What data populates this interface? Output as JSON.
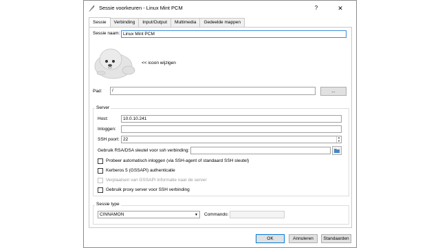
{
  "window": {
    "title": "Sessie voorkeuren - Linux Mint PCM",
    "help_label": "?",
    "close_label": "✕"
  },
  "tabs": [
    {
      "label": "Sessie",
      "active": true
    },
    {
      "label": "Verbinding",
      "active": false
    },
    {
      "label": "Input/Output",
      "active": false
    },
    {
      "label": "Multimedia",
      "active": false
    },
    {
      "label": "Gedeelde mappen",
      "active": false
    }
  ],
  "session": {
    "name_label": "Sessie naam:",
    "name_value": "Linux Mint PCM",
    "change_icon_label": "<< icoon wijzigen",
    "path_label": "Pad:",
    "path_value": "/",
    "browse_label": "..."
  },
  "server": {
    "group_title": "Server",
    "host_label": "Host:",
    "host_value": "10.0.10.241",
    "login_label": "Inloggen:",
    "login_value": "",
    "port_label": "SSH poort:",
    "port_value": "22",
    "key_label": "Gebruik RSA/DSA sleutel voor ssh verbinding:",
    "key_value": "",
    "options": [
      {
        "label": "Probeer automatisch inloggen (via SSH-agent of standaard SSH sleutel)",
        "checked": false,
        "disabled": false
      },
      {
        "label": "Kerberos 5 (GSSAPI) authenticatie",
        "checked": false,
        "disabled": false
      },
      {
        "label": "Verplaatsen van GSSAPI informatie naar de server",
        "checked": false,
        "disabled": true
      },
      {
        "label": "Gebruik proxy server voor SSH verbinding",
        "checked": false,
        "disabled": false
      }
    ]
  },
  "session_type": {
    "group_title": "Sessie type",
    "selected": "CINNAMON",
    "command_label": "Commando:",
    "command_value": ""
  },
  "buttons": {
    "ok": "OK",
    "cancel": "Annuleren",
    "defaults": "Standaarden"
  },
  "colors": {
    "focus_border": "#3c8ad8",
    "default_button_border": "#0078d7",
    "folder_icon": "#4a86c8"
  }
}
